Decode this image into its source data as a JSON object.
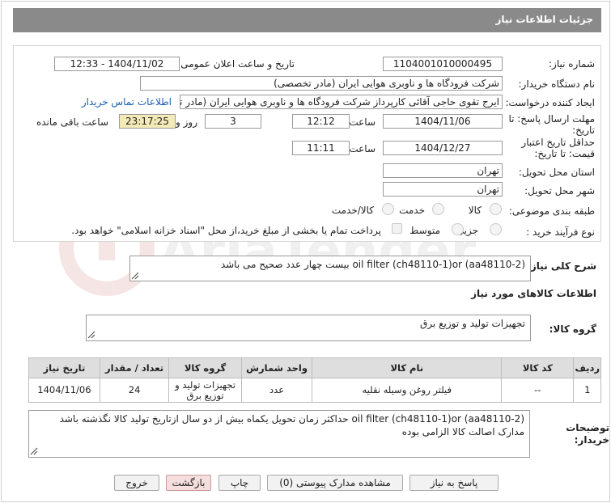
{
  "header": {
    "title": "جزئیات اطلاعات نیاز"
  },
  "form": {
    "need_number_label": "شماره نیاز:",
    "need_number": "1104001010000495",
    "announce_label": "تاریخ و ساعت اعلان عمومی:",
    "announce_value": "1404/11/02 - 12:33",
    "buyer_label": "نام دستگاه خریدار:",
    "buyer_value": "شرکت فرودگاه ها و ناوبری هوایی ایران (مادر تخصصی)",
    "creator_label": "ایجاد کننده درخواست:",
    "creator_value": "ایرج تقوی حاجی آقائی کارپرداز شرکت فرودگاه ها و ناوبری هوایی ایران (مادر تخصصی)",
    "contact_link": "اطلاعات تماس خریدار",
    "deadline_label_line1": "مهلت ارسال پاسخ: تا",
    "deadline_label_line2": "تاریخ:",
    "deadline_date": "1404/11/06",
    "time_label": "ساعت",
    "deadline_time": "12:12",
    "days_value": "3",
    "days_label": "روز و",
    "remaining_time": "23:17:25",
    "remaining_label": "ساعت باقی مانده",
    "validity_label_line1": "حداقل تاریخ اعتبار",
    "validity_label_line2": "قیمت: تا تاریخ:",
    "validity_date": "1404/12/27",
    "validity_time": "11:11",
    "province_label": "استان محل تحویل:",
    "province_value": "تهران",
    "city_label": "شهر محل تحویل:",
    "city_value": "تهران",
    "category_label": "طبقه بندی موضوعی:",
    "category_options": [
      "کالا",
      "خدمت",
      "کالا/خدمت"
    ],
    "process_label": "نوع فرآیند خرید :",
    "process_options": [
      "جزیی",
      "متوسط"
    ],
    "payment_note": "پرداخت تمام یا بخشی از مبلغ خرید،از محل \"اسناد خزانه اسلامی\" خواهد بود."
  },
  "description": {
    "label": "شرح کلی نیاز:",
    "value": "oil filter (ch48110-1)or (aa48110-2) بیست چهار عدد صحیح می باشد"
  },
  "goods_section": {
    "title": "اطلاعات کالاهای مورد نیاز",
    "group_label": "گروه کالا:",
    "group_value": "تجهیزات تولید و توزیع برق"
  },
  "table": {
    "headers": [
      "ردیف",
      "کد کالا",
      "نام کالا",
      "واحد شمارش",
      "گروه کالا",
      "تعداد / مقدار",
      "تاریخ نیاز"
    ],
    "row": {
      "index": "1",
      "code": "--",
      "name": "فیلتر روغن وسیله نقلیه",
      "unit": "عدد",
      "group_line1": "تجهیزات تولید و",
      "group_line2": "توزیع برق",
      "qty": "24",
      "date": "1404/11/06"
    }
  },
  "buyer_notes": {
    "label_line1": "توضیحات",
    "label_line2": "خریدار:",
    "value": "oil filter (ch48110-1)or (aa48110-2) حداکثر زمان تحویل یکماه بیش از دو سال ازتاریخ تولید کالا نگذشته باشد مدارک اصالت کالا الزامی بوده"
  },
  "buttons": {
    "reply": "پاسخ به نیاز",
    "attachments": "مشاهده مدارک پیوستی (0)",
    "print": "چاپ",
    "back": "بازگشت",
    "exit": "خروج"
  },
  "watermark_text": "AriaTender.net"
}
